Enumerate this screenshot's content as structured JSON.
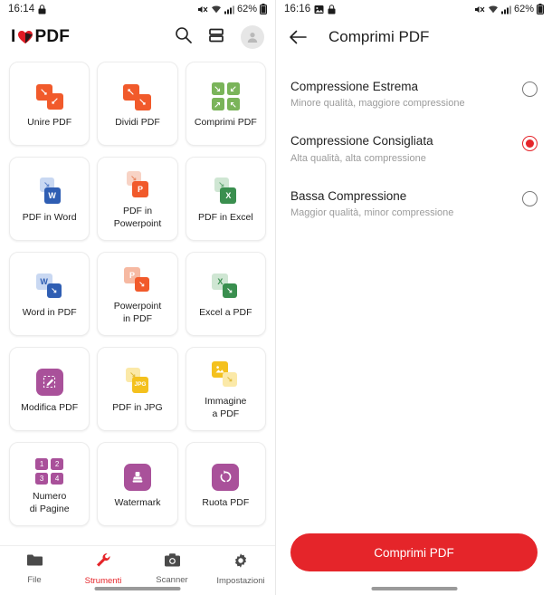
{
  "left": {
    "status": {
      "time": "16:14",
      "lock_icon": "lock-icon",
      "mute_icon": "mute-icon",
      "wifi_icon": "wifi-icon",
      "signal_icon": "signal-icon",
      "battery": "62%"
    },
    "appbar": {
      "logo_i": "I",
      "logo_pdf": "PDF",
      "heart_icon": "heart-icon",
      "search_icon": "search-icon",
      "layout_icon": "layout-toggle-icon",
      "avatar_icon": "account-avatar-icon"
    },
    "tools": [
      {
        "label": "Unire PDF",
        "icon": "merge-pdf-icon",
        "color": "#f15a2b"
      },
      {
        "label": "Dividi PDF",
        "icon": "split-pdf-icon",
        "color": "#f15a2b"
      },
      {
        "label": "Comprimi PDF",
        "icon": "compress-pdf-icon",
        "color": "#7ab45a"
      },
      {
        "label": "PDF in Word",
        "icon": "pdf-to-word-icon",
        "color": "#2f5eb3"
      },
      {
        "label": "PDF in\nPowerpoint",
        "icon": "pdf-to-ppt-icon",
        "color": "#f15a2b"
      },
      {
        "label": "PDF in Excel",
        "icon": "pdf-to-excel-icon",
        "color": "#3a8f4f"
      },
      {
        "label": "Word in PDF",
        "icon": "word-to-pdf-icon",
        "color": "#2f5eb3"
      },
      {
        "label": "Powerpoint\nin PDF",
        "icon": "ppt-to-pdf-icon",
        "color": "#f15a2b"
      },
      {
        "label": "Excel a PDF",
        "icon": "excel-to-pdf-icon",
        "color": "#3a8f4f"
      },
      {
        "label": "Modifica PDF",
        "icon": "edit-pdf-icon",
        "color": "#a9519a"
      },
      {
        "label": "PDF in JPG",
        "icon": "pdf-to-jpg-icon",
        "color": "#f4c11e"
      },
      {
        "label": "Immagine\na PDF",
        "icon": "image-to-pdf-icon",
        "color": "#f4c11e"
      },
      {
        "label": "Numero\ndi Pagine",
        "icon": "page-numbers-icon",
        "color": "#a9519a"
      },
      {
        "label": "Watermark",
        "icon": "watermark-icon",
        "color": "#a9519a"
      },
      {
        "label": "Ruota PDF",
        "icon": "rotate-pdf-icon",
        "color": "#a9519a"
      }
    ],
    "nav": [
      {
        "label": "File",
        "icon": "folder-icon",
        "active": false
      },
      {
        "label": "Strumenti",
        "icon": "wrench-icon",
        "active": true
      },
      {
        "label": "Scanner",
        "icon": "camera-icon",
        "active": false
      },
      {
        "label": "Impostazioni",
        "icon": "gear-icon",
        "active": false
      }
    ]
  },
  "right": {
    "status": {
      "time": "16:16",
      "image_icon": "image-icon",
      "lock_icon": "lock-icon",
      "mute_icon": "mute-icon",
      "wifi_icon": "wifi-icon",
      "signal_icon": "signal-icon",
      "battery": "62%"
    },
    "appbar": {
      "back_icon": "back-arrow-icon",
      "title": "Comprimi PDF"
    },
    "options": [
      {
        "title": "Compressione Estrema",
        "subtitle": "Minore qualità, maggiore compressione",
        "selected": false
      },
      {
        "title": "Compressione Consigliata",
        "subtitle": "Alta qualità, alta compressione",
        "selected": true
      },
      {
        "title": "Bassa Compressione",
        "subtitle": "Maggior qualità, minor compressione",
        "selected": false
      }
    ],
    "cta_label": "Comprimi PDF"
  },
  "colors": {
    "accent_red": "#e5252a",
    "selected_radio": "#e5252a"
  }
}
